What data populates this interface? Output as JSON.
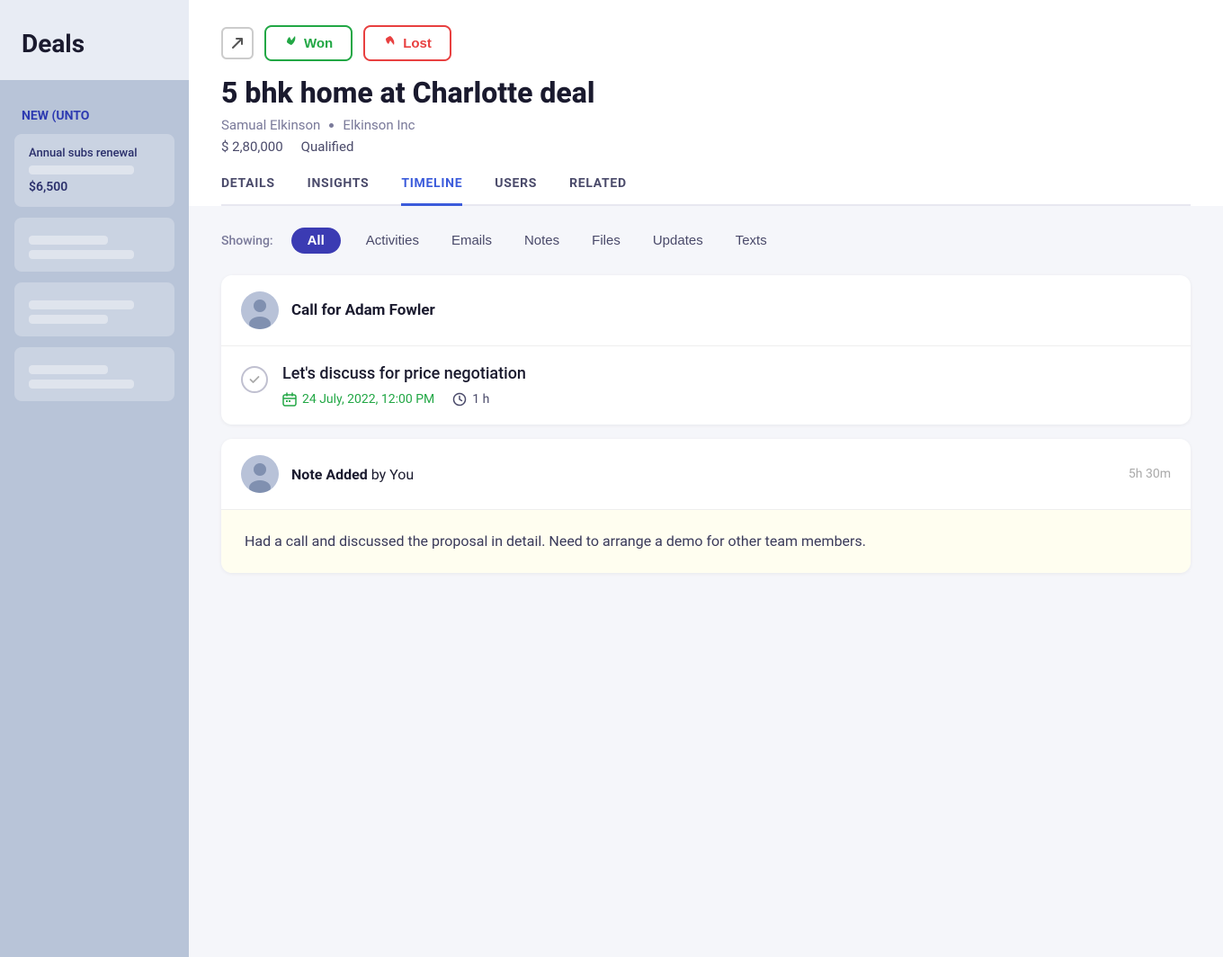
{
  "sidebar": {
    "title": "Deals",
    "section_label": "NEW (UNTO",
    "card1": {
      "title": "Annual subs renewal",
      "amount": "$6,500"
    }
  },
  "header": {
    "won_label": "Won",
    "lost_label": "Lost",
    "deal_title": "5 bhk home at Charlotte deal",
    "contact_name": "Samual Elkinson",
    "company": "Elkinson Inc",
    "price": "$ 2,80,000",
    "stage": "Qualified"
  },
  "nav": {
    "tabs": [
      {
        "id": "details",
        "label": "DETAILS"
      },
      {
        "id": "insights",
        "label": "INSIGHTS"
      },
      {
        "id": "timeline",
        "label": "TIMELINE"
      },
      {
        "id": "users",
        "label": "USERS"
      },
      {
        "id": "related",
        "label": "RELATED"
      }
    ],
    "active_tab": "timeline"
  },
  "timeline": {
    "showing_label": "Showing:",
    "filters": [
      {
        "id": "all",
        "label": "All",
        "active": true
      },
      {
        "id": "activities",
        "label": "Activities",
        "active": false
      },
      {
        "id": "emails",
        "label": "Emails",
        "active": false
      },
      {
        "id": "notes",
        "label": "Notes",
        "active": false
      },
      {
        "id": "files",
        "label": "Files",
        "active": false
      },
      {
        "id": "updates",
        "label": "Updates",
        "active": false
      },
      {
        "id": "texts",
        "label": "Texts",
        "active": false
      }
    ],
    "activity_card": {
      "title": "Call for Adam Fowler",
      "task_title": "Let's discuss for price negotiation",
      "date": "24 July, 2022, 12:00 PM",
      "duration": "1 h"
    },
    "note_card": {
      "prefix": "Note Added",
      "by": "by You",
      "time_ago": "5h 30m",
      "body": "Had a call and discussed the proposal in detail. Need to arrange a demo for other team members."
    }
  },
  "icons": {
    "won_icon": "👍",
    "lost_icon": "👎",
    "external_link": "↗",
    "calendar": "📅",
    "clock": "🕐",
    "check": "✓"
  }
}
